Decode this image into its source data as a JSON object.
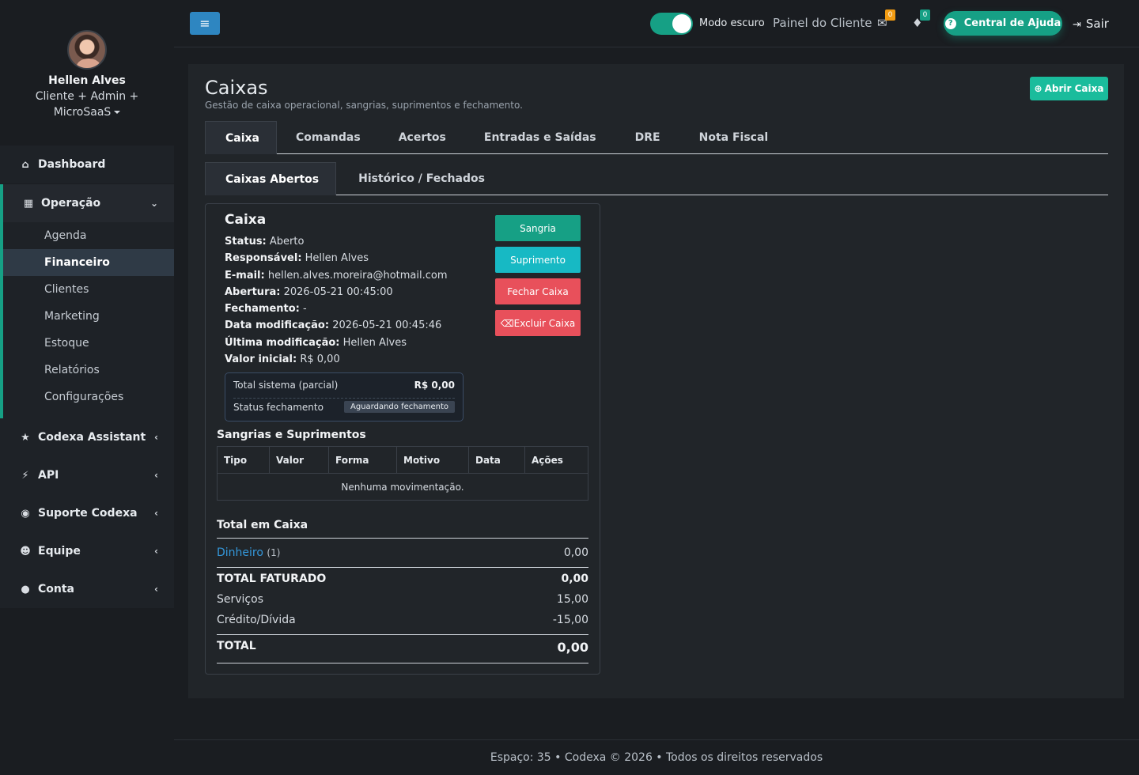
{
  "profile": {
    "name": "Hellen Alves",
    "role_line1": "Cliente + Admin +",
    "role_line2": "MicroSaaS"
  },
  "sidebar": {
    "dashboard": "Dashboard",
    "operacao": "Operação",
    "sub_items": [
      "Agenda",
      "Financeiro",
      "Clientes",
      "Marketing",
      "Estoque",
      "Relatórios",
      "Configurações"
    ],
    "groups": [
      "Codexa Assistant",
      "API",
      "Suporte Codexa",
      "Equipe",
      "Conta"
    ]
  },
  "topbar": {
    "dark_mode_label": "Modo escuro",
    "panel_link": "Painel do Cliente",
    "mail_count": "0",
    "bell_count": "0",
    "help_label": "Central de Ajuda",
    "logout_label": "Sair"
  },
  "page": {
    "title": "Caixas",
    "subtitle": "Gestão de caixa operacional, sangrias, suprimentos e fechamento.",
    "open_button": "Abrir Caixa"
  },
  "tabs": [
    "Caixa",
    "Comandas",
    "Acertos",
    "Entradas e Saídas",
    "DRE",
    "Nota Fiscal"
  ],
  "subtabs": [
    "Caixas Abertos",
    "Histórico / Fechados"
  ],
  "caixa": {
    "title": "Caixa",
    "fields": [
      {
        "label": "Status:",
        "value": "Aberto"
      },
      {
        "label": "Responsável:",
        "value": "Hellen Alves"
      },
      {
        "label": "E-mail:",
        "value": "hellen.alves.moreira@hotmail.com"
      },
      {
        "label": "Abertura:",
        "value": "2026-05-21 00:45:00"
      },
      {
        "label": "Fechamento:",
        "value": "-"
      },
      {
        "label": "Data modificação:",
        "value": "2026-05-21 00:45:46"
      },
      {
        "label": "Última modificação:",
        "value": "Hellen Alves"
      },
      {
        "label": "Valor inicial:",
        "value": "R$ 0,00"
      }
    ],
    "buttons": {
      "sangria": "Sangria",
      "suprimento": "Suprimento",
      "fechar": "Fechar Caixa",
      "excluir": "Excluir Caixa"
    },
    "summary": {
      "total_label": "Total sistema (parcial)",
      "total_value": "R$ 0,00",
      "status_label": "Status fechamento",
      "status_value": "Aguardando fechamento"
    }
  },
  "movimentos": {
    "title": "Sangrias e Suprimentos",
    "columns": [
      "Tipo",
      "Valor",
      "Forma",
      "Motivo",
      "Data",
      "Ações"
    ],
    "empty": "Nenhuma movimentação."
  },
  "totais": {
    "title": "Total em Caixa",
    "dinheiro_label": "Dinheiro",
    "dinheiro_count": "(1)",
    "dinheiro_value": "0,00",
    "faturado_label": "TOTAL FATURADO",
    "faturado_value": "0,00",
    "servicos_label": "Serviços",
    "servicos_value": "15,00",
    "credito_label": "Crédito/Dívida",
    "credito_value": "-15,00",
    "total_label": "TOTAL",
    "total_value": "0,00"
  },
  "footer": "Espaço: 35 • Codexa © 2026 • Todos os direitos reservados",
  "colors": {
    "accent": "#16a085",
    "primary": "#2e86c1",
    "info": "#1abc9c",
    "danger": "#e8505b",
    "badge_orange": "#f39c12"
  }
}
